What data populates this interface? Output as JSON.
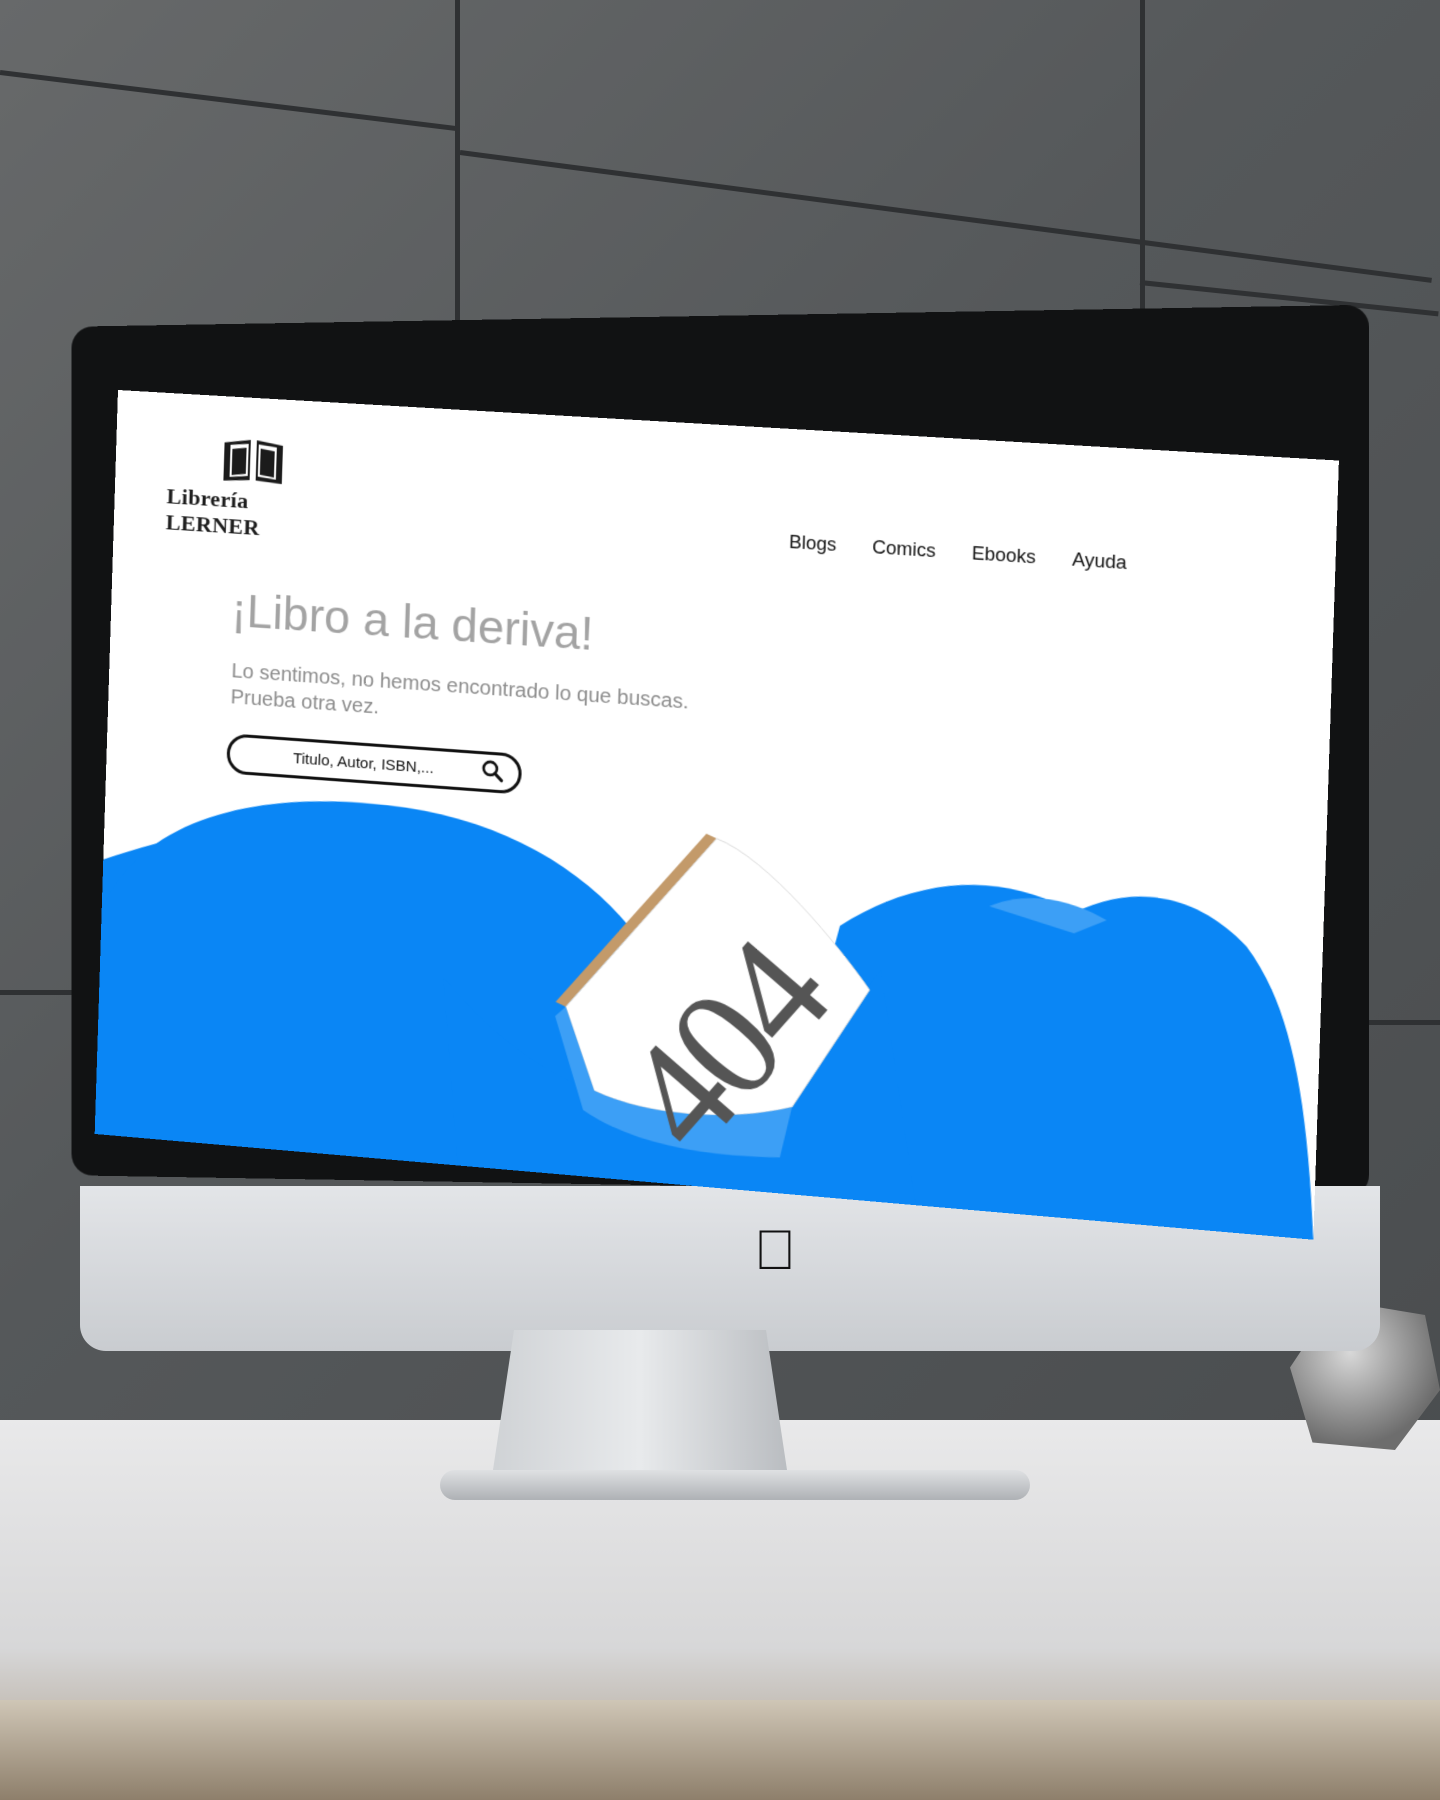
{
  "site": {
    "logo_text": "Librería LERNER"
  },
  "nav": {
    "items": [
      {
        "label": "Blogs"
      },
      {
        "label": "Comics"
      },
      {
        "label": "Ebooks"
      },
      {
        "label": "Ayuda"
      }
    ]
  },
  "error": {
    "headline": "¡Libro a la deriva!",
    "message_line1": "Lo sentimos, no hemos encontrado lo que buscas.",
    "message_line2": "Prueba otra vez.",
    "code": "404"
  },
  "search": {
    "placeholder": "Titulo, Autor, ISBN,..."
  },
  "icons": {
    "logo": "open-book-icon",
    "search": "magnifier-icon",
    "device": "apple-logo-icon"
  },
  "colors": {
    "wave_primary": "#0a86f5",
    "wave_light": "#3c9ff6",
    "headline": "#a3a3a3",
    "text_dark": "#111111"
  }
}
